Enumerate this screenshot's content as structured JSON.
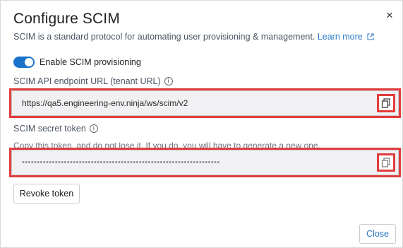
{
  "dialog": {
    "title": "Configure SCIM",
    "description": "SCIM is a standard protocol for automating user provisioning & management.",
    "learn_more": "Learn more",
    "close_symbol": "×"
  },
  "toggle": {
    "label": "Enable SCIM provisioning",
    "enabled": true
  },
  "endpoint": {
    "label": "SCIM API endpoint URL (tenant URL)",
    "value": "https://qa5.engineering-env.ninja/ws/scim/v2",
    "info_icon": "info-icon",
    "copy_icon": "copy-icon"
  },
  "token": {
    "label": "SCIM secret token",
    "warning": "Copy this token, and do not lose it. If you do, you will have to generate a new one.",
    "value": "••••••••••••••••••••••••••••••••••••••••••••••••••••••••••••••••••",
    "info_icon": "info-icon",
    "copy_icon": "copy-icon"
  },
  "buttons": {
    "revoke": "Revoke token",
    "close": "Close"
  },
  "colors": {
    "accent": "#1a73c9",
    "link": "#2a78c5",
    "highlight": "#e23c3c",
    "input_bg": "#f1f1f3"
  }
}
